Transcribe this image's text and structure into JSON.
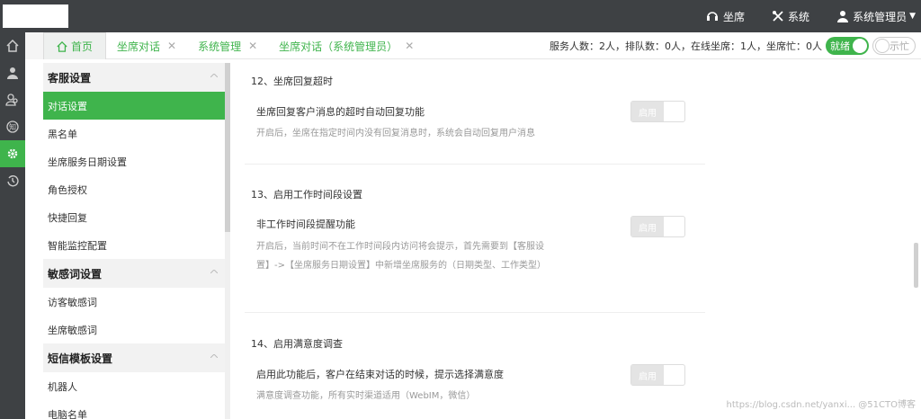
{
  "topbar": {
    "nav": [
      {
        "label": "坐席",
        "icon": "headset-icon"
      },
      {
        "label": "系统",
        "icon": "tools-icon"
      },
      {
        "label": "系统管理员",
        "icon": "user-icon"
      }
    ]
  },
  "rail": [
    "home-icon",
    "person-icon",
    "people-icon",
    "knowledge-icon",
    "settings-icon",
    "history-icon"
  ],
  "tabs": {
    "home": "首页",
    "items": [
      {
        "label": "坐席对话"
      },
      {
        "label": "系统管理"
      },
      {
        "label": "坐席对话（系统管理员）"
      }
    ]
  },
  "status": {
    "summary": "服务人数：2人，排队数：0人，在线坐席：1人，坐席忙：0人",
    "ready_label": "就绪",
    "busy_label": "示忙"
  },
  "sidebar": {
    "groups": [
      {
        "title": "客服设置",
        "items": [
          "对话设置",
          "黑名单",
          "坐席服务日期设置",
          "角色授权",
          "快捷回复",
          "智能监控配置"
        ]
      },
      {
        "title": "敏感词设置",
        "items": [
          "访客敏感词",
          "坐席敏感词"
        ]
      },
      {
        "title": "短信模板设置",
        "items": [
          "机器人",
          "电脑名单"
        ]
      }
    ]
  },
  "sections": [
    {
      "title": "12、坐席回复超时",
      "feature": "坐席回复客户消息的超时自动回复功能",
      "desc": "开启后，坐席在指定时间内没有回复消息时，系统会自动回复用户消息",
      "switch_label": "启用"
    },
    {
      "title": "13、启用工作时间段设置",
      "feature": "非工作时间段提醒功能",
      "desc": "开启后，当前时间不在工作时间段内访问将会提示，首先需要到【客服设置】->【坐席服务日期设置】中新增坐席服务的（日期类型、工作类型）",
      "switch_label": "启用"
    },
    {
      "title": "14、启用满意度调查",
      "feature": "启用此功能后，客户在结束对话的时候，提示选择满意度",
      "desc": "满意度调查功能，所有实时渠道适用（WebIM，微信）",
      "switch_label": "启用"
    }
  ],
  "watermark": "https://blog.csdn.net/yanxi...  @51CTO博客"
}
